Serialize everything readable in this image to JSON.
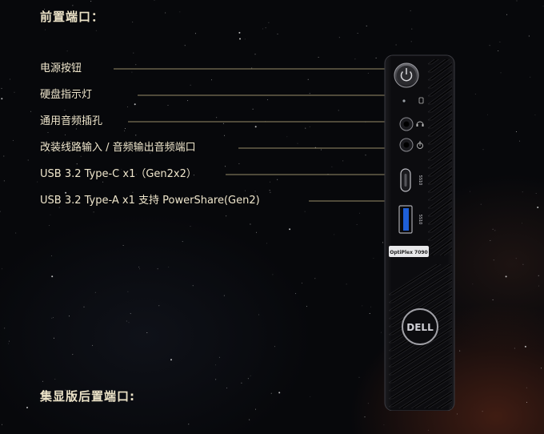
{
  "headings": {
    "front": "前置端口：",
    "rear": "集显版后置端口:"
  },
  "ports": [
    {
      "id": "power-button",
      "label": "电源按钮"
    },
    {
      "id": "hdd-indicator",
      "label": "硬盘指示灯"
    },
    {
      "id": "audio-jack",
      "label": "通用音频插孔"
    },
    {
      "id": "line-out",
      "label": "改装线路输入 / 音频输出音频端口"
    },
    {
      "id": "usb-c",
      "label": "USB 3.2 Type-C x1（Gen2x2）"
    },
    {
      "id": "usb-a",
      "label": "USB 3.2 Type-A x1 支持 PowerShare(Gen2)"
    }
  ],
  "device": {
    "model_badge": "OptiPlex 7090",
    "logo": "DELL",
    "usb_c_port_label": "SS10",
    "usb_a_port_label": "SS10"
  },
  "colors": {
    "label_text": "#efe6cc",
    "leader_line": "#c8b98a",
    "usb_a_blue": "#1e5fd8",
    "device_body": "#0d0d10"
  }
}
